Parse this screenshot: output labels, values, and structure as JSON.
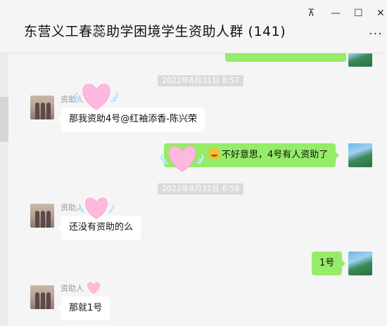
{
  "window": {
    "title": "东营义工春蕊助学困境学生资助人群 (141)",
    "controls": {
      "pin": "⊼",
      "minimize": "—",
      "maximize": "☐",
      "close": "✕",
      "more": "···"
    }
  },
  "messages": [
    {
      "type": "time",
      "text": "2022年8月31日 8:57"
    },
    {
      "type": "in",
      "sender": "资助人",
      "text": "那我资助4号@红袖添香-陈兴荣"
    },
    {
      "type": "out",
      "emoji": "grin-emoji",
      "text": "不好意思，4号有人资助了"
    },
    {
      "type": "time",
      "text": "2022年8月31日 8:58"
    },
    {
      "type": "in",
      "sender": "资助人",
      "text": "还没有资助的么"
    },
    {
      "type": "out",
      "text": "1号"
    },
    {
      "type": "in",
      "sender": "资助人",
      "text": "那就1号"
    }
  ],
  "colors": {
    "outgoing_bubble": "#95ec69",
    "incoming_bubble": "#ffffff",
    "background": "#f5f5f5",
    "heart": "#ffb8de"
  }
}
